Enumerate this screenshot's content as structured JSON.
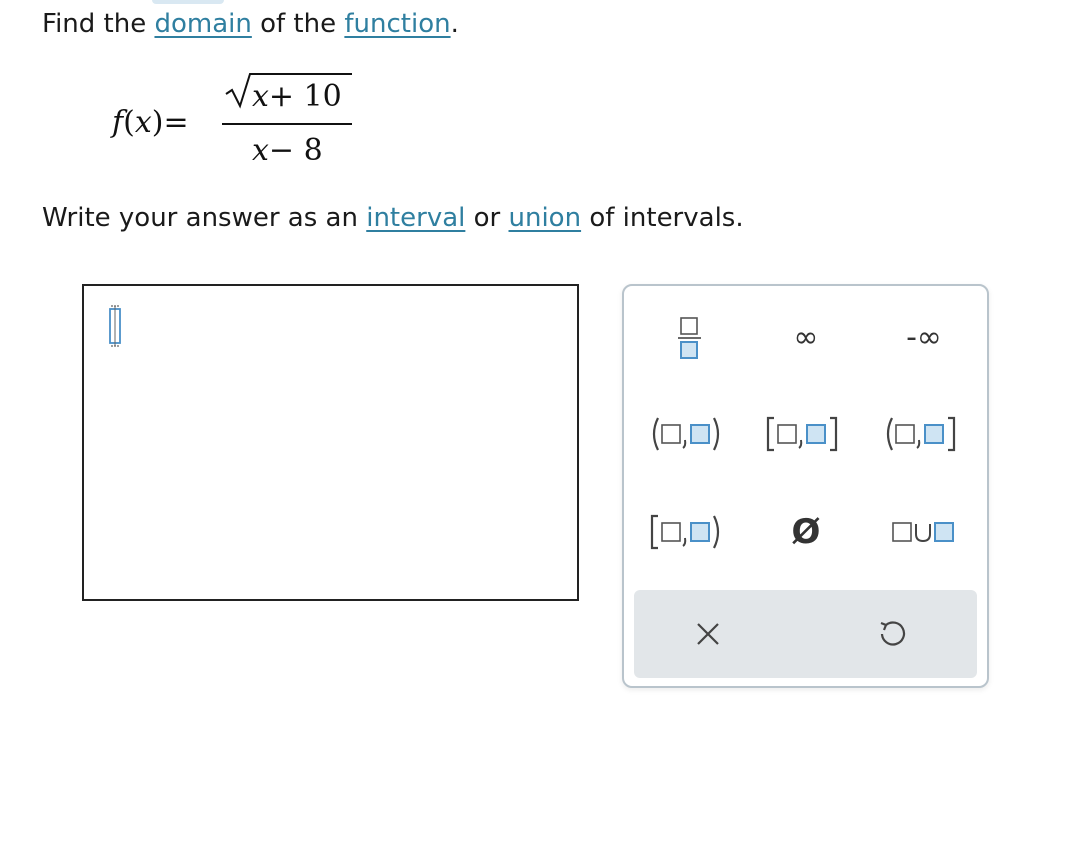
{
  "question": {
    "prefix": "Find the ",
    "link1": "domain",
    "middle": " of the ",
    "link2": "function",
    "suffix": "."
  },
  "formula": {
    "lhs_f": "f",
    "lhs_paren_open": "(",
    "lhs_x": "x",
    "lhs_paren_close": ")",
    "equals": "=",
    "numerator_var": "x",
    "numerator_rest": "+ 10",
    "denominator_var": "x",
    "denominator_rest": "− 8"
  },
  "instruction": {
    "prefix": "Write your answer as an ",
    "link1": "interval",
    "middle": " or ",
    "link2": "union",
    "suffix": " of intervals."
  },
  "palette": {
    "infinity": "∞",
    "neg_infinity": "-∞",
    "empty_set": "Ø"
  },
  "colors": {
    "link": "#2f7fa0",
    "template_box": "#4a90c8",
    "palette_border": "#b9c4cc",
    "bottom_bar": "#e2e6e9"
  },
  "icons": {
    "fraction": "fraction-template-icon",
    "open_open": "interval-open-open-icon",
    "closed_closed": "interval-closed-closed-icon",
    "open_closed": "interval-open-closed-icon",
    "closed_open": "interval-closed-open-icon",
    "union": "union-template-icon",
    "clear": "close-icon",
    "undo": "undo-icon",
    "cursor": "text-cursor-icon"
  }
}
